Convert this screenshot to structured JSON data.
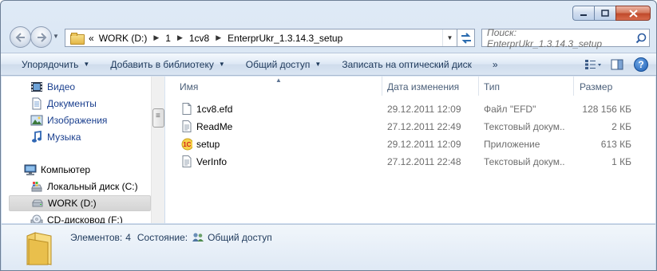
{
  "address": {
    "overflow": "«",
    "crumbs": [
      "WORK (D:)",
      "1",
      "1cv8",
      "EnterprUkr_1.3.14.3_setup"
    ]
  },
  "search": {
    "placeholder": "Поиск: EnterprUkr_1.3.14.3_setup"
  },
  "toolbar": {
    "organize": "Упорядочить",
    "add_to_library": "Добавить в библиотеку",
    "share": "Общий доступ",
    "burn": "Записать на оптический диск",
    "more": "»"
  },
  "nav_pane": {
    "libraries": [
      {
        "label": "Видео",
        "icon": "video-library-icon"
      },
      {
        "label": "Документы",
        "icon": "documents-library-icon"
      },
      {
        "label": "Изображения",
        "icon": "pictures-library-icon"
      },
      {
        "label": "Музыка",
        "icon": "music-library-icon"
      }
    ],
    "computer": "Компьютер",
    "drives": [
      {
        "label": "Локальный диск (C:)",
        "icon": "local-disk-icon"
      },
      {
        "label": "WORK (D:)",
        "icon": "drive-icon",
        "selected": true
      },
      {
        "label": "CD-дисковод (F:)",
        "icon": "cd-drive-icon"
      }
    ]
  },
  "columns": {
    "name": "Имя",
    "date": "Дата изменения",
    "type": "Тип",
    "size": "Размер"
  },
  "files": [
    {
      "name": "1cv8.efd",
      "date": "29.12.2011 12:09",
      "type": "Файл \"EFD\"",
      "size": "128 156 КБ",
      "icon": "file-icon"
    },
    {
      "name": "ReadMe",
      "date": "27.12.2011 22:49",
      "type": "Текстовый докум...",
      "size": "2 КБ",
      "icon": "text-file-icon"
    },
    {
      "name": "setup",
      "date": "29.12.2011 12:09",
      "type": "Приложение",
      "size": "613 КБ",
      "icon": "1c-setup-icon"
    },
    {
      "name": "VerInfo",
      "date": "27.12.2011 22:48",
      "type": "Текстовый докум...",
      "size": "1 КБ",
      "icon": "text-file-icon"
    }
  ],
  "status": {
    "items_label": "Элементов:",
    "items_count": "4",
    "state_label": "Состояние:",
    "state_value": "Общий доступ"
  },
  "colors": {
    "accent": "#1e395b",
    "selection": "#d9d9d9",
    "close": "#c74a2b"
  }
}
